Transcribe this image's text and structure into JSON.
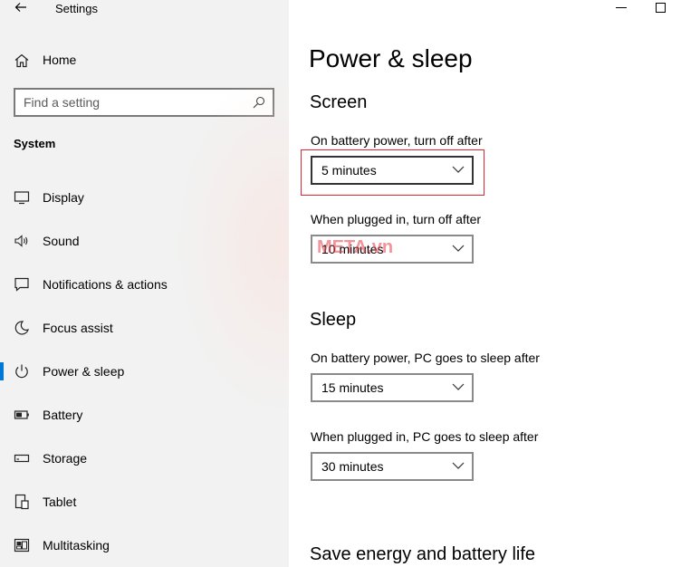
{
  "window": {
    "title": "Settings"
  },
  "sidebar": {
    "home_label": "Home",
    "search_placeholder": "Find a setting",
    "section_label": "System",
    "items": [
      {
        "label": "Display",
        "icon": "display-icon"
      },
      {
        "label": "Sound",
        "icon": "sound-icon"
      },
      {
        "label": "Notifications & actions",
        "icon": "notifications-icon"
      },
      {
        "label": "Focus assist",
        "icon": "focus-assist-icon"
      },
      {
        "label": "Power & sleep",
        "icon": "power-icon",
        "active": true
      },
      {
        "label": "Battery",
        "icon": "battery-icon"
      },
      {
        "label": "Storage",
        "icon": "storage-icon"
      },
      {
        "label": "Tablet",
        "icon": "tablet-icon"
      },
      {
        "label": "Multitasking",
        "icon": "multitasking-icon"
      }
    ]
  },
  "main": {
    "title": "Power & sleep",
    "screen": {
      "heading": "Screen",
      "battery_label": "On battery power, turn off after",
      "battery_value": "5 minutes",
      "plugged_label": "When plugged in, turn off after",
      "plugged_value": "10 minutes"
    },
    "sleep": {
      "heading": "Sleep",
      "battery_label": "On battery power, PC goes to sleep after",
      "battery_value": "15 minutes",
      "plugged_label": "When plugged in, PC goes to sleep after",
      "plugged_value": "30 minutes"
    },
    "save_energy_heading": "Save energy and battery life"
  },
  "watermark": "META.vn",
  "colors": {
    "accent": "#0078d7",
    "highlight": "#e0262e",
    "sidebar_bg": "#f2f2f2"
  }
}
